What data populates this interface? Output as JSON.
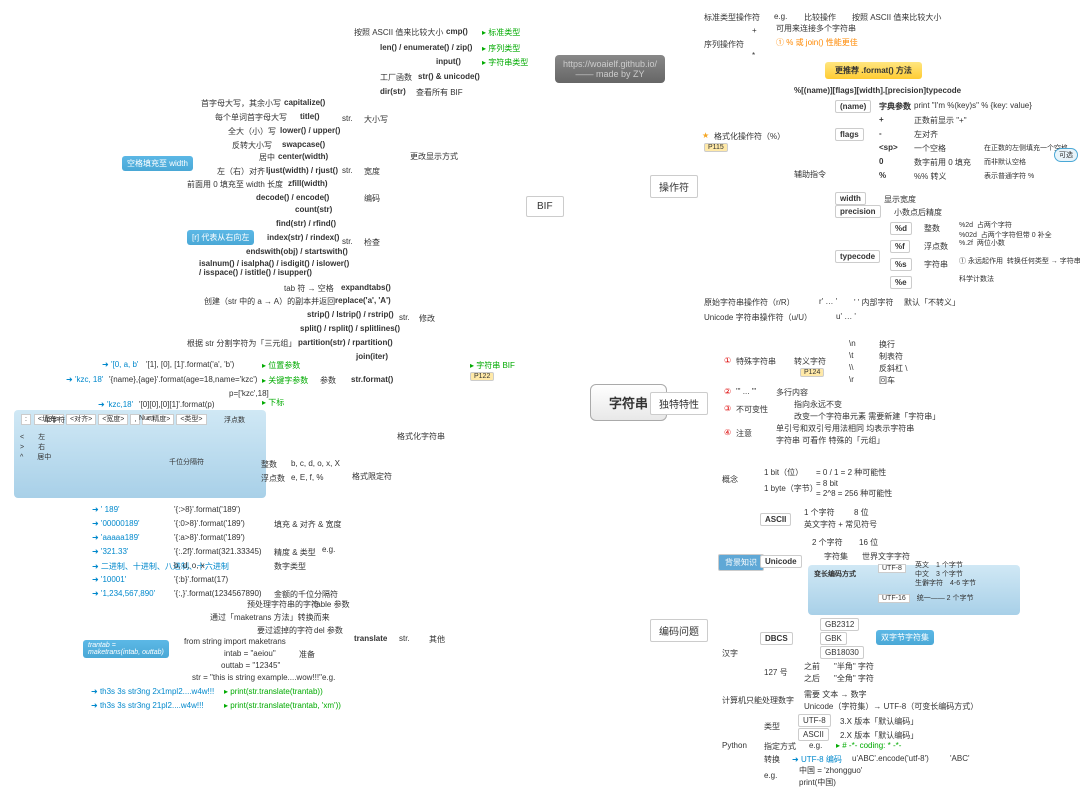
{
  "center": "字符串",
  "watermark": "https://woaielf.github.io/\n—— made by ZY",
  "bif": {
    "label": "BIF",
    "items": [
      {
        "a": "按照 ASCII 值来比较大小",
        "b": "cmp()",
        "tag": "标准类型"
      },
      {
        "a": "",
        "b": "len() / enumerate() / zip()",
        "tag": "序列类型"
      },
      {
        "a": "",
        "b": "input()",
        "tag": "字符串类型"
      },
      {
        "a": "工厂函数",
        "b": "str() & unicode()"
      },
      {
        "a": "",
        "b": "dir(str)",
        "c": "查看所有 BIF"
      }
    ]
  },
  "str_methods": {
    "case": {
      "label": "大小写",
      "items": [
        {
          "a": "首字母大写，其余小写",
          "b": "capitalize()"
        },
        {
          "a": "每个单词首字母大写",
          "b": "title()"
        },
        {
          "a": "全大（小）写",
          "b": "lower() / upper()"
        },
        {
          "a": "反转大小写",
          "b": "swapcase()"
        }
      ]
    },
    "align": {
      "items": [
        {
          "a": "居中",
          "b": "center(width)"
        },
        {
          "a": "左（右）对齐",
          "b": "ljust(width) / rjust()",
          "c": "宽度"
        },
        {
          "a": "前面用 0 填充至 width 长度",
          "b": "zfill(width)"
        },
        {
          "a": "",
          "b": "decode() / encode()",
          "c": "编码"
        }
      ]
    },
    "space_note": "空格填充至 width",
    "display": "更改显示方式",
    "check": {
      "label": "检查",
      "items": [
        {
          "b": "count(str)"
        },
        {
          "b": "find(str) / rfind()"
        },
        {
          "b": "index(str) / rindex()",
          "note": "[r] 代表从右向左"
        },
        {
          "b": "endswith(obj) / startswith()"
        },
        {
          "b": "isalnum() / isalpha() / isdigit() / islower()\n/ isspace() / istitle() / isupper()"
        }
      ]
    },
    "modify": {
      "label": "修改",
      "items": [
        {
          "a": "tab 符 → 空格",
          "b": "expandtabs()"
        },
        {
          "a": "创建（str 中的 a → A）的副本并返回",
          "b": "replace('a', 'A')"
        },
        {
          "b": "strip() / lstrip() / rstrip()"
        },
        {
          "b": "split() / rsplit() / splitlines()"
        },
        {
          "a": "根据 str 分割字符为「三元组」",
          "b": "partition(str) / rpartition()"
        },
        {
          "b": "join(iter)"
        }
      ]
    },
    "format": {
      "label": "str.format()",
      "pos": [
        "'[0, a, b'",
        "'[1], [0], [1]'.format('a', 'b')",
        "位置参数"
      ],
      "kw": [
        "'kzc, 18'",
        "'{name},{age}'.format(age=18,name='kzc')",
        "关键字参数"
      ],
      "sub": [
        "'kzc,18'",
        "'[0][0],[0][1]'.format(p)",
        "下标",
        "p=['kzc',18]"
      ]
    }
  },
  "fmt_spec": {
    "label": "格式化字符串",
    "sub": "格式限定符",
    "template": [
      ":",
      "<填充>",
      "<对齐>",
      "<宽度>",
      "Num",
      ",",
      "<.精度>",
      "<类型>",
      "浮点数"
    ],
    "align": [
      [
        "<",
        "左"
      ],
      [
        ">",
        "右"
      ],
      [
        "^",
        "居中"
      ]
    ],
    "thousand": "千位分隔符",
    "types": [
      [
        "整数",
        "b, c, d, o, x, X"
      ],
      [
        "浮点数",
        "e, E, f, %"
      ]
    ],
    "single": "单字符",
    "examples": [
      [
        "'  189'",
        "'{:>8}'.format('189')"
      ],
      [
        "'00000189'",
        "'{:0>8}'.format('189')",
        "填充 & 对齐 & 宽度"
      ],
      [
        "'aaaaa189'",
        "'{:a>8}'.format('189')"
      ],
      [
        "'321.33'",
        "'{:.2f}'.format(321.33345)",
        "精度 & 类型"
      ],
      [
        "二进制、十进制、八进制、十六进制",
        "b, d, o, x",
        "数字类型"
      ],
      [
        "'10001'",
        "'{:b}'.format(17)"
      ],
      [
        "'1,234,567,890'",
        "'{:,}'.format(1234567890)",
        "金额的千位分隔符"
      ]
    ]
  },
  "translate": {
    "label": "translate",
    "str": "str.",
    "other": "其他",
    "items": [
      "预处理字符串的字符",
      "通过「maketrans 方法」转换而来",
      "要过滤掉的字符"
    ],
    "params": [
      "table 参数",
      "del 参数"
    ],
    "prep": {
      "label": "准备",
      "code": [
        "from string import maketrans",
        "intab = \"aeiou\"",
        "outtab = \"12345\"",
        "str = \"this is string example....wow!!!\""
      ],
      "eg": "e.g."
    },
    "note": "trantab = \nmaketrans(intab, outtab)",
    "eg": [
      [
        "th3s 3s str3ng 2x1mpl2....w4w!!!",
        "print(str.translate(trantab))"
      ],
      [
        "th3s 3s str3ng 21pl2....w4w!!!",
        "print(str.translate(trantab, 'xm'))"
      ]
    ]
  },
  "ops": {
    "label": "操作符",
    "items": [
      {
        "a": "标准类型操作符",
        "b": "e.g.",
        "c": "比较操作",
        "d": "按照 ASCII 值来比较大小"
      },
      {
        "a": "序列操作符",
        "sub": [
          [
            "",
            "可用来连接多个字符串"
          ],
          [
            "+",
            ""
          ],
          [
            "①",
            "% 或 join() 性能更佳"
          ],
          [
            "*",
            ""
          ]
        ]
      },
      {
        "a": "格式化操作符（%）",
        "tag": "P115",
        "banner": "更推荐 .format() 方法",
        "fmt": "%[(name)][flags][width].[precision]typecode",
        "aux": "辅助指令",
        "rows": [
          [
            "(name)",
            "字典参数",
            "print \"I'm %(key)s\" % {key: value}"
          ],
          [
            "flags",
            "+",
            "正数前显示 \"+\"",
            " "
          ],
          [
            "",
            "-",
            "左对齐",
            ""
          ],
          [
            "",
            "<sp>",
            "一个空格",
            "在正数的左侧填充一个空格\n从而    与负数对齐"
          ],
          [
            "",
            "0",
            "数字前用 0 填充",
            "而非默认空格"
          ],
          [
            "",
            "%",
            "%%",
            "转义    表示普通字符 %"
          ],
          [
            "width",
            "",
            "显示宽度",
            ""
          ],
          [
            "precision",
            "",
            "小数点后精度",
            ""
          ]
        ],
        "tc": {
          "label": "typecode",
          "rows": [
            [
              "%d",
              "整数",
              "%2d  占两个字符\n%02d  占两个字符但带 0 补全"
            ],
            [
              "%f",
              "浮点数",
              "%.2f  两位小数"
            ],
            [
              "%s",
              "字符串",
              "① 永远起作用  转换任何类型 → 字符串"
            ],
            [
              "%e",
              "",
              "科学计数法"
            ]
          ]
        },
        "optional": "可选"
      },
      {
        "a": "原始字符串操作符（r/R）",
        "b": "r' … '",
        "c": "' ' 内部字符",
        "d": "默认「不转义」"
      },
      {
        "a": "Unicode 字符串操作符（u/U）",
        "b": "u' … '"
      }
    ]
  },
  "unique": {
    "label": "独特特性",
    "items": [
      {
        "a": "特殊字符串",
        "b": "转义字符",
        "tag": "P124",
        "rows": [
          [
            "\\n",
            "换行"
          ],
          [
            "\\t",
            "制表符"
          ],
          [
            "\\\\",
            "反斜杠  \\"
          ],
          [
            "\\r",
            "回车"
          ]
        ]
      },
      {
        "a": "''' ... '''",
        "b": "多行内容"
      },
      {
        "a": "不可变性",
        "rows": [
          "指向永远不变",
          "改变一个字符串元素  需要新建「字符串」"
        ]
      },
      {
        "a": "注意",
        "rows": [
          "单引号和双引号用法相同  均表示字符串",
          "字符串  可看作  特殊的「元组」"
        ]
      }
    ]
  },
  "encoding": {
    "label": "编码问题",
    "bg": {
      "label": "背景知识",
      "concept": {
        "label": "概念",
        "rows": [
          [
            "1 bit（位）",
            "= 0 / 1 = 2 种可能性"
          ],
          [
            "1 byte（字节）",
            "= 8 bit\n= 2^8 = 256 种可能性"
          ]
        ]
      },
      "ascii": {
        "label": "ASCII",
        "rows": [
          [
            "1 个字符",
            "8 位"
          ],
          [
            "英文字符 + 常见符号",
            ""
          ]
        ]
      },
      "unicode": {
        "label": "Unicode",
        "rows": [
          [
            "2 个字符",
            "16 位"
          ],
          [
            "字符集",
            "世界文字字符"
          ]
        ],
        "varlen": {
          "label": "变长编码方式",
          "utf8": {
            "label": "UTF-8",
            "rows": [
              [
                "英文",
                "1 个字节"
              ],
              [
                "中文",
                "3 个字节"
              ],
              [
                "生僻字符",
                "4-6 字节"
              ]
            ]
          },
          "utf16": [
            "UTF-16",
            "统一——   2 个字节"
          ]
        }
      }
    },
    "hanzi": {
      "label": "汉字",
      "dbcs": {
        "label": "DBCS",
        "items": [
          "GB2312",
          "GBK",
          "GB18030"
        ],
        "note": "双字节字符集"
      },
      "127": {
        "label": "127 号",
        "rows": [
          [
            "之前",
            "\"半角\" 字符"
          ],
          [
            "之后",
            "\"全角\" 字符"
          ]
        ]
      }
    },
    "compute": {
      "label": "计算机只能处理数字",
      "rows": [
        "需要  文本 → 数字",
        "Unicode（字符集）→ UTF-8（可变长编码方式）"
      ]
    },
    "python": {
      "label": "Python",
      "type": {
        "label": "类型",
        "rows": [
          [
            "UTF-8",
            "3.X 版本「默认编码」"
          ],
          [
            "ASCII",
            "2.X 版本「默认编码」"
          ]
        ]
      },
      "spec": [
        "指定方式",
        "e.g.",
        "# -*- coding: * -*-"
      ],
      "conv": [
        "转换",
        "UTF-8 编码",
        "u'ABC'.encode('utf-8')",
        "'ABC'"
      ],
      "eg": [
        "e.g.",
        "中国 = 'zhongguo'",
        "print(中国)"
      ]
    }
  }
}
